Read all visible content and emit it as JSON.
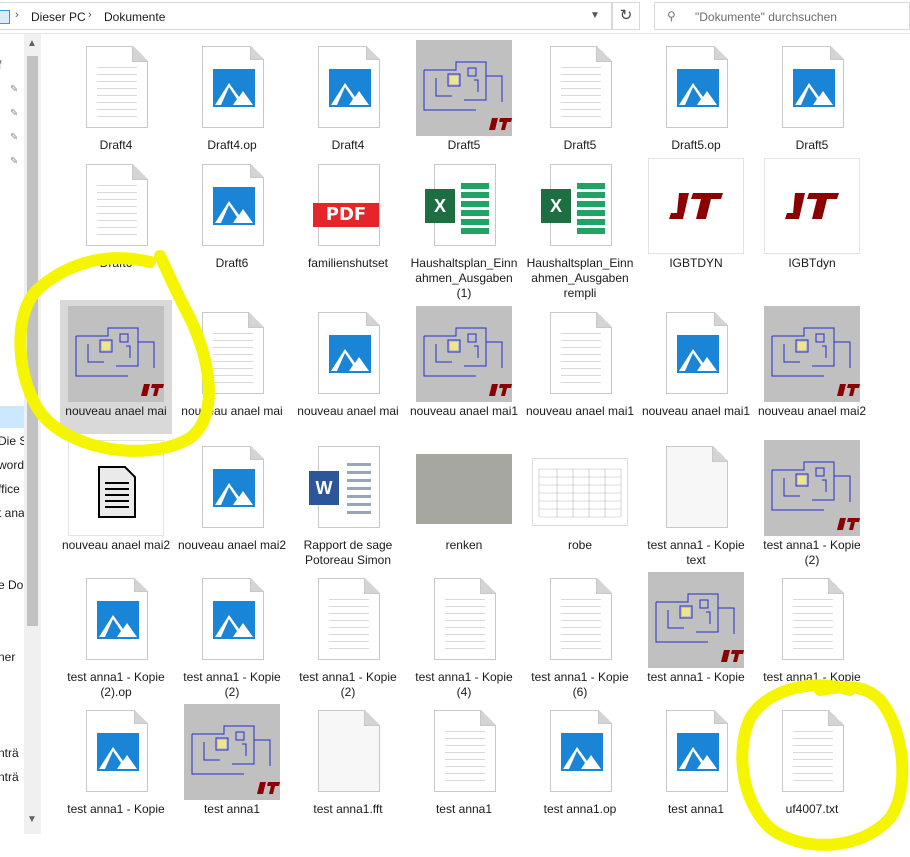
{
  "address_bar": {
    "crumbs": [
      "Dieser PC",
      "Dokumente"
    ],
    "search_placeholder": "\"Dokumente\" durchsuchen"
  },
  "nav_pane": {
    "partial_labels": [
      "f",
      "Die Sp",
      "word",
      "ffice",
      "t ana",
      "e Dok",
      "l",
      "ner",
      "nträ",
      "nträ"
    ]
  },
  "accent_colors": {
    "selection": "#cce8ff",
    "annotation": "#f5f500"
  },
  "files": [
    {
      "name": "Draft4",
      "icon": "document-icon"
    },
    {
      "name": "Draft4.op",
      "icon": "image-icon"
    },
    {
      "name": "Draft4",
      "icon": "image-icon"
    },
    {
      "name": "Draft5",
      "icon": "circuit-thumbnail"
    },
    {
      "name": "Draft5",
      "icon": "document-icon"
    },
    {
      "name": "Draft5.op",
      "icon": "image-icon"
    },
    {
      "name": "Draft5",
      "icon": "image-icon"
    },
    {
      "name": "Draft6",
      "icon": "document-icon"
    },
    {
      "name": "Draft6",
      "icon": "image-icon"
    },
    {
      "name": "familienshutset",
      "icon": "pdf-icon"
    },
    {
      "name": "Haushaltsplan_Einnahmen_Ausgaben (1)",
      "icon": "excel-icon"
    },
    {
      "name": "Haushaltsplan_Einnahmen_Ausgaben rempli",
      "icon": "excel-icon"
    },
    {
      "name": "IGBTDYN",
      "icon": "ltspice-icon"
    },
    {
      "name": "IGBTdyn",
      "icon": "ltspice-icon"
    },
    {
      "name": "nouveau anael mai",
      "icon": "circuit-thumbnail"
    },
    {
      "name": "nouveau anael mai",
      "icon": "document-icon"
    },
    {
      "name": "nouveau anael mai",
      "icon": "image-icon"
    },
    {
      "name": "nouveau anael mai1",
      "icon": "circuit-thumbnail"
    },
    {
      "name": "nouveau anael mai1",
      "icon": "document-icon"
    },
    {
      "name": "nouveau anael mai1",
      "icon": "image-icon"
    },
    {
      "name": "nouveau anael mai2",
      "icon": "circuit-thumbnail"
    },
    {
      "name": "nouveau anael mai2",
      "icon": "generic-document-icon"
    },
    {
      "name": "nouveau anael mai2",
      "icon": "image-icon"
    },
    {
      "name": "Rapport de sage Potoreau Simon",
      "icon": "word-icon"
    },
    {
      "name": "renken",
      "icon": "photo-thumbnail"
    },
    {
      "name": "robe",
      "icon": "table-thumbnail"
    },
    {
      "name": "test anna1 - Kopie  text",
      "icon": "plain-file-icon"
    },
    {
      "name": "test anna1 - Kopie (2)",
      "icon": "circuit-thumbnail"
    },
    {
      "name": "test anna1 - Kopie (2).op",
      "icon": "image-icon"
    },
    {
      "name": "test anna1 - Kopie (2)",
      "icon": "image-icon"
    },
    {
      "name": "test anna1 - Kopie (2)",
      "icon": "document-icon"
    },
    {
      "name": "test anna1 - Kopie (4)",
      "icon": "document-icon"
    },
    {
      "name": "test anna1 - Kopie (6)",
      "icon": "document-icon"
    },
    {
      "name": "test anna1 - Kopie",
      "icon": "circuit-thumbnail"
    },
    {
      "name": "test anna1 - Kopie",
      "icon": "document-icon"
    },
    {
      "name": "test anna1 - Kopie",
      "icon": "image-icon"
    },
    {
      "name": "test anna1",
      "icon": "circuit-thumbnail"
    },
    {
      "name": "test anna1.fft",
      "icon": "plain-file-icon"
    },
    {
      "name": "test anna1",
      "icon": "document-icon"
    },
    {
      "name": "test anna1.op",
      "icon": "image-icon"
    },
    {
      "name": "test anna1",
      "icon": "image-icon"
    },
    {
      "name": "uf4007.txt",
      "icon": "document-icon"
    }
  ]
}
